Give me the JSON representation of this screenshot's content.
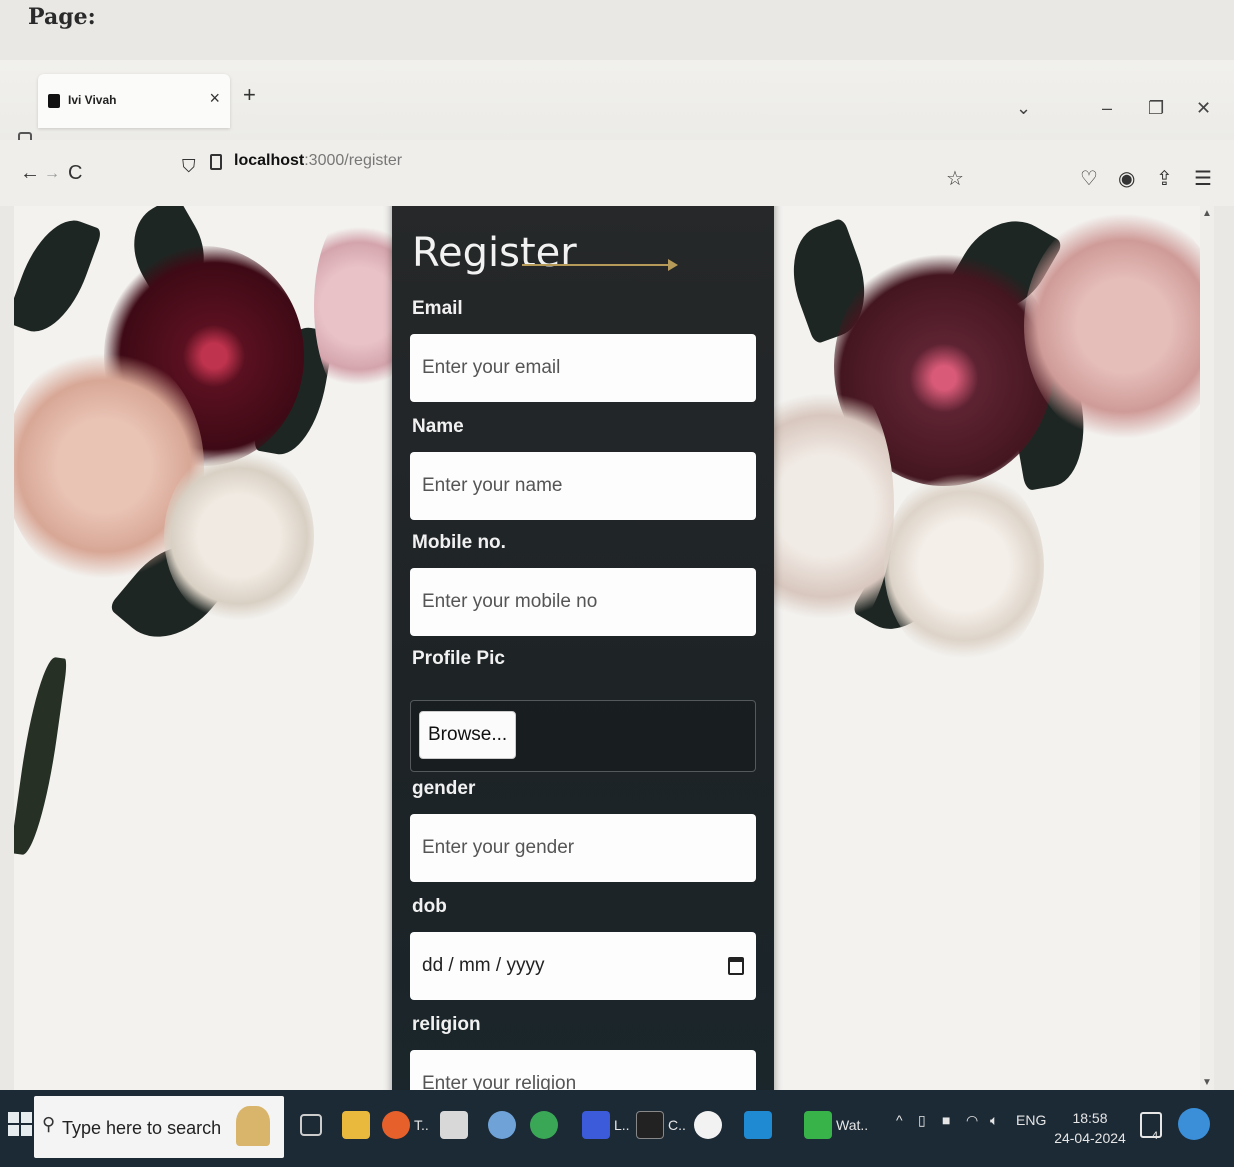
{
  "paper": {
    "heading": "Page:"
  },
  "browser": {
    "tab_title": "Ivi Vivah",
    "tab_close": "×",
    "new_tab": "+",
    "url_host": "localhost",
    "url_path": ":3000/register",
    "window_controls": {
      "dropdown": "⌄",
      "minimize": "–",
      "restore": "❐",
      "close": "✕"
    },
    "nav": {
      "back": "←",
      "forward": "→",
      "reload": "C"
    }
  },
  "form": {
    "title": "Register",
    "fields": {
      "email": {
        "label": "Email",
        "placeholder": "Enter your email"
      },
      "name": {
        "label": "Name",
        "placeholder": "Enter your name"
      },
      "mobile": {
        "label": "Mobile no.",
        "placeholder": "Enter your mobile no"
      },
      "profile_pic": {
        "label": "Profile Pic",
        "button": "Browse..."
      },
      "gender": {
        "label": "gender",
        "placeholder": "Enter your gender"
      },
      "dob": {
        "label": "dob",
        "value": "dd / mm / yyyy"
      },
      "religion": {
        "label": "religion",
        "placeholder": "Enter your religion"
      }
    }
  },
  "taskbar": {
    "search_placeholder": "Type here to search",
    "apps": [
      {
        "label": "T.."
      },
      {
        "label": "L.."
      },
      {
        "label": "C.."
      },
      {
        "label": "Wat.."
      }
    ],
    "language": "ENG",
    "time": "18:58",
    "date": "24-04-2024",
    "notification_count": "4"
  },
  "colors": {
    "card_bg": "#23282a",
    "gold_accent": "#b69a5a",
    "taskbar_bg": "#1c2a36"
  }
}
